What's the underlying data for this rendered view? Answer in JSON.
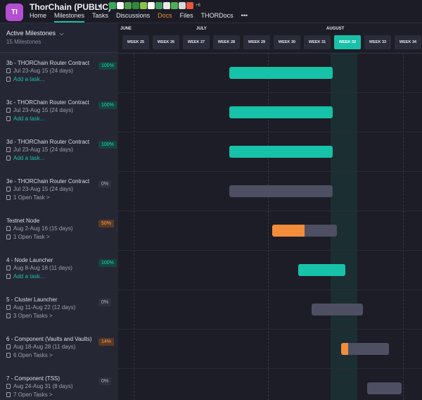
{
  "project": {
    "initials": "TI",
    "name": "ThorChain (PUBLIC)",
    "chevron": "▾",
    "avatar_extra": "+6",
    "avatar_colors": [
      "#3aa85a",
      "#ffffff",
      "#4c9b4a",
      "#2f8a3c",
      "#8bc34a",
      "#ffffff",
      "#3f9f5e",
      "#e8e8e8",
      "#4caf50",
      "#d9d9d9",
      "#e8573d"
    ]
  },
  "nav": {
    "items": [
      {
        "label": "Home",
        "active": false
      },
      {
        "label": "Milestones",
        "active": true
      },
      {
        "label": "Tasks",
        "active": false
      },
      {
        "label": "Discussions",
        "active": false
      },
      {
        "label": "Docs",
        "active": false
      },
      {
        "label": "Files",
        "active": false
      },
      {
        "label": "THORDocs",
        "active": false
      }
    ],
    "more": "•••"
  },
  "sidebar": {
    "title": "Active Milestones",
    "chevron": "⌵",
    "count": "15 Milestones"
  },
  "timeline": {
    "months": [
      "JUNE",
      "JULY",
      "AUGUST"
    ],
    "weeks": [
      "WEEK 25",
      "WEEK 26",
      "WEEK 27",
      "WEEK 28",
      "WEEK 29",
      "WEEK 30",
      "WEEK 31",
      "WEEK 32",
      "WEEK 33",
      "WEEK 34"
    ],
    "current_week": "WEEK 32"
  },
  "milestones": [
    {
      "name": "3b - THORChain Router Contract",
      "dates": "Jul 23-Aug 15 (24 days)",
      "task": "Add a task...",
      "task_type": "add",
      "progress": "100%",
      "progress_value": 100,
      "status": "done"
    },
    {
      "name": "3c - THORChain Router Contract",
      "dates": "Jul 23-Aug 15 (24 days)",
      "task": "Add a task...",
      "task_type": "add",
      "progress": "100%",
      "progress_value": 100,
      "status": "done"
    },
    {
      "name": "3d - THORChain Router Contract",
      "dates": "Jul 23-Aug 15 (24 days)",
      "task": "Add a task...",
      "task_type": "add",
      "progress": "100%",
      "progress_value": 100,
      "status": "done"
    },
    {
      "name": "3e - THORChain Router Contract",
      "dates": "Jul 23-Aug 15 (24 days)",
      "task": "1 Open Task >",
      "task_type": "open",
      "progress": "0%",
      "progress_value": 0,
      "status": "zero"
    },
    {
      "name": "Testnet Node",
      "dates": "Aug 2-Aug 16 (15 days)",
      "task": "1 Open Task >",
      "task_type": "open",
      "progress": "50%",
      "progress_value": 50,
      "status": "part"
    },
    {
      "name": "4 - Node Launcher",
      "dates": "Aug 8-Aug 18 (11 days)",
      "task": "Add a task...",
      "task_type": "add",
      "progress": "100%",
      "progress_value": 100,
      "status": "done"
    },
    {
      "name": "5 - Cluster Launcher",
      "dates": "Aug 11-Aug 22 (12 days)",
      "task": "3 Open Tasks >",
      "task_type": "open",
      "progress": "0%",
      "progress_value": 0,
      "status": "zero"
    },
    {
      "name": "6 - Component (Vaults and Vaults)",
      "dates": "Aug 18-Aug 28 (11 days)",
      "task": "6 Open Tasks >",
      "task_type": "open",
      "progress": "14%",
      "progress_value": 14,
      "status": "part"
    },
    {
      "name": "7 - Component (TSS)",
      "dates": "Aug 24-Aug 31 (8 days)",
      "task": "7 Open Tasks >",
      "task_type": "open",
      "progress": "0%",
      "progress_value": 0,
      "status": "zero"
    }
  ]
}
